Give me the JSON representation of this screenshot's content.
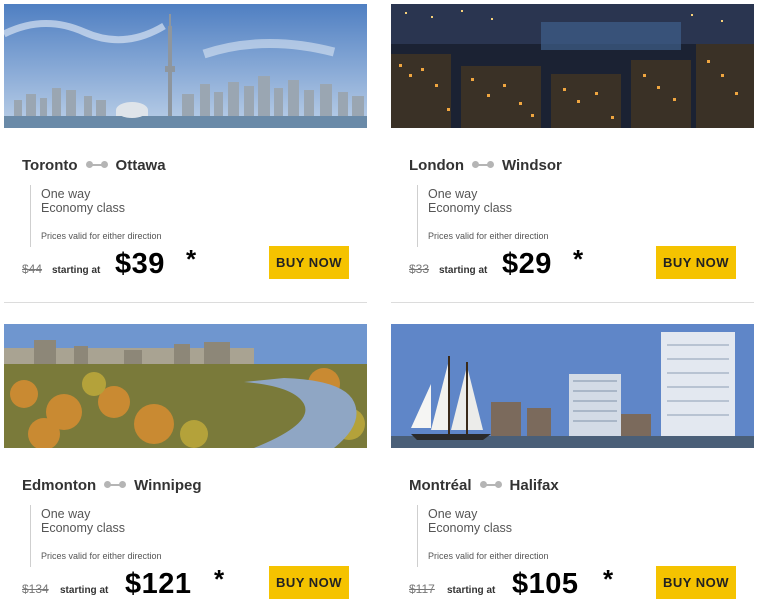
{
  "deals": [
    {
      "from": "Toronto",
      "to": "Ottawa",
      "trip_type": "One way",
      "cabin": "Economy class",
      "validity": "Prices valid for either direction",
      "old_price": "$44",
      "starting_label": "starting at",
      "price": "$39",
      "asterisk": "*",
      "button_label": "BUY NOW",
      "photo_icon": "city-skyline-photo"
    },
    {
      "from": "London",
      "to": "Windsor",
      "trip_type": "One way",
      "cabin": "Economy class",
      "validity": "Prices valid for either direction",
      "old_price": "$33",
      "starting_label": "starting at",
      "price": "$29",
      "asterisk": "*",
      "button_label": "BUY NOW",
      "photo_icon": "night-city-photo"
    },
    {
      "from": "Edmonton",
      "to": "Winnipeg",
      "trip_type": "One way",
      "cabin": "Economy class",
      "validity": "Prices valid for either direction",
      "old_price": "$134",
      "starting_label": "starting at",
      "price": "$121",
      "asterisk": "*",
      "button_label": "BUY NOW",
      "photo_icon": "river-valley-photo"
    },
    {
      "from": "Montréal",
      "to": "Halifax",
      "trip_type": "One way",
      "cabin": "Economy class",
      "validity": "Prices valid for either direction",
      "old_price": "$117",
      "starting_label": "starting at",
      "price": "$105",
      "asterisk": "*",
      "button_label": "BUY NOW",
      "photo_icon": "harbour-sailboat-photo"
    }
  ],
  "colors": {
    "button": "#f5c300",
    "connector": "#b5b5b5"
  }
}
